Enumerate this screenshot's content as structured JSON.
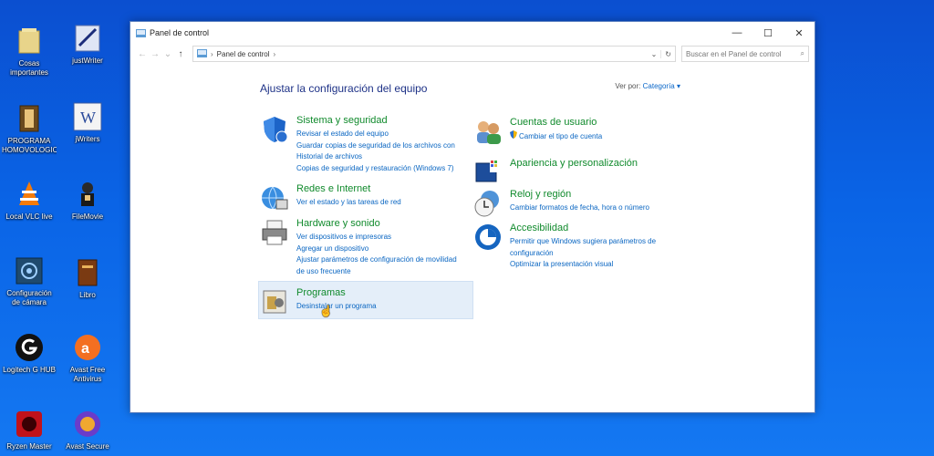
{
  "desktop": {
    "icons": [
      {
        "label": "Cosas importantes",
        "icon": "folder-icon"
      },
      {
        "label": "justWriter",
        "icon": "app-icon"
      },
      {
        "label": "PROGRAMA HOMOVOLOGICO",
        "icon": "program-icon"
      },
      {
        "label": "jWriters",
        "icon": "writer-icon"
      },
      {
        "label": "Local VLC live",
        "icon": "vlc-icon"
      },
      {
        "label": "FileMovie",
        "icon": "movie-icon"
      },
      {
        "label": "Configuración de cámara logitech",
        "icon": "camera-icon"
      },
      {
        "label": "Libro",
        "icon": "book-icon"
      },
      {
        "label": "Logitech G HUB",
        "icon": "logitech-icon"
      },
      {
        "label": "Avast Free Antivirus",
        "icon": "avast-icon"
      },
      {
        "label": "Ryzen Master",
        "icon": "ryzen-icon"
      },
      {
        "label": "Avast Secure",
        "icon": "avast-secure-icon"
      }
    ]
  },
  "window": {
    "title": "Panel de control",
    "controls": {
      "minimize": "—",
      "maximize": "☐",
      "close": "✕"
    },
    "nav": {
      "back": "←",
      "forward": "→",
      "recent": "⌄",
      "up": "↑"
    },
    "address": {
      "arrow1": "›",
      "location": "Panel de control",
      "arrow2": "›",
      "dropdown": "⌄",
      "refresh": "↻"
    },
    "search": {
      "placeholder": "Buscar en el Panel de control",
      "icon": "⌕"
    },
    "heading": "Ajustar la configuración del equipo",
    "view_by": {
      "label": "Ver por:",
      "value": "Categoría ▾"
    },
    "categories_left": [
      {
        "title": "Sistema y seguridad",
        "icon": "shield-icon",
        "links": [
          "Revisar el estado del equipo",
          "Guardar copias de seguridad de los archivos con Historial de archivos",
          "Copias de seguridad y restauración (Windows 7)"
        ]
      },
      {
        "title": "Redes e Internet",
        "icon": "network-icon",
        "links": [
          "Ver el estado y las tareas de red"
        ]
      },
      {
        "title": "Hardware y sonido",
        "icon": "printer-icon",
        "links": [
          "Ver dispositivos e impresoras",
          "Agregar un dispositivo",
          "Ajustar parámetros de configuración de movilidad de uso frecuente"
        ]
      },
      {
        "title": "Programas",
        "icon": "programs-icon",
        "links": [
          "Desinstalar un programa"
        ]
      }
    ],
    "categories_right": [
      {
        "title": "Cuentas de usuario",
        "icon": "users-icon",
        "links": [
          "Cambiar el tipo de cuenta"
        ]
      },
      {
        "title": "Apariencia y personalización",
        "icon": "appearance-icon",
        "links": []
      },
      {
        "title": "Reloj y región",
        "icon": "clock-icon",
        "links": [
          "Cambiar formatos de fecha, hora o número"
        ]
      },
      {
        "title": "Accesibilidad",
        "icon": "accessibility-icon",
        "links": [
          "Permitir que Windows sugiera parámetros de configuración",
          "Optimizar la presentación visual"
        ]
      }
    ]
  },
  "colors": {
    "accent": "#0a66c2",
    "category_title": "#108a2c",
    "heading": "#1e3287",
    "desktop": "#0a64e6"
  }
}
